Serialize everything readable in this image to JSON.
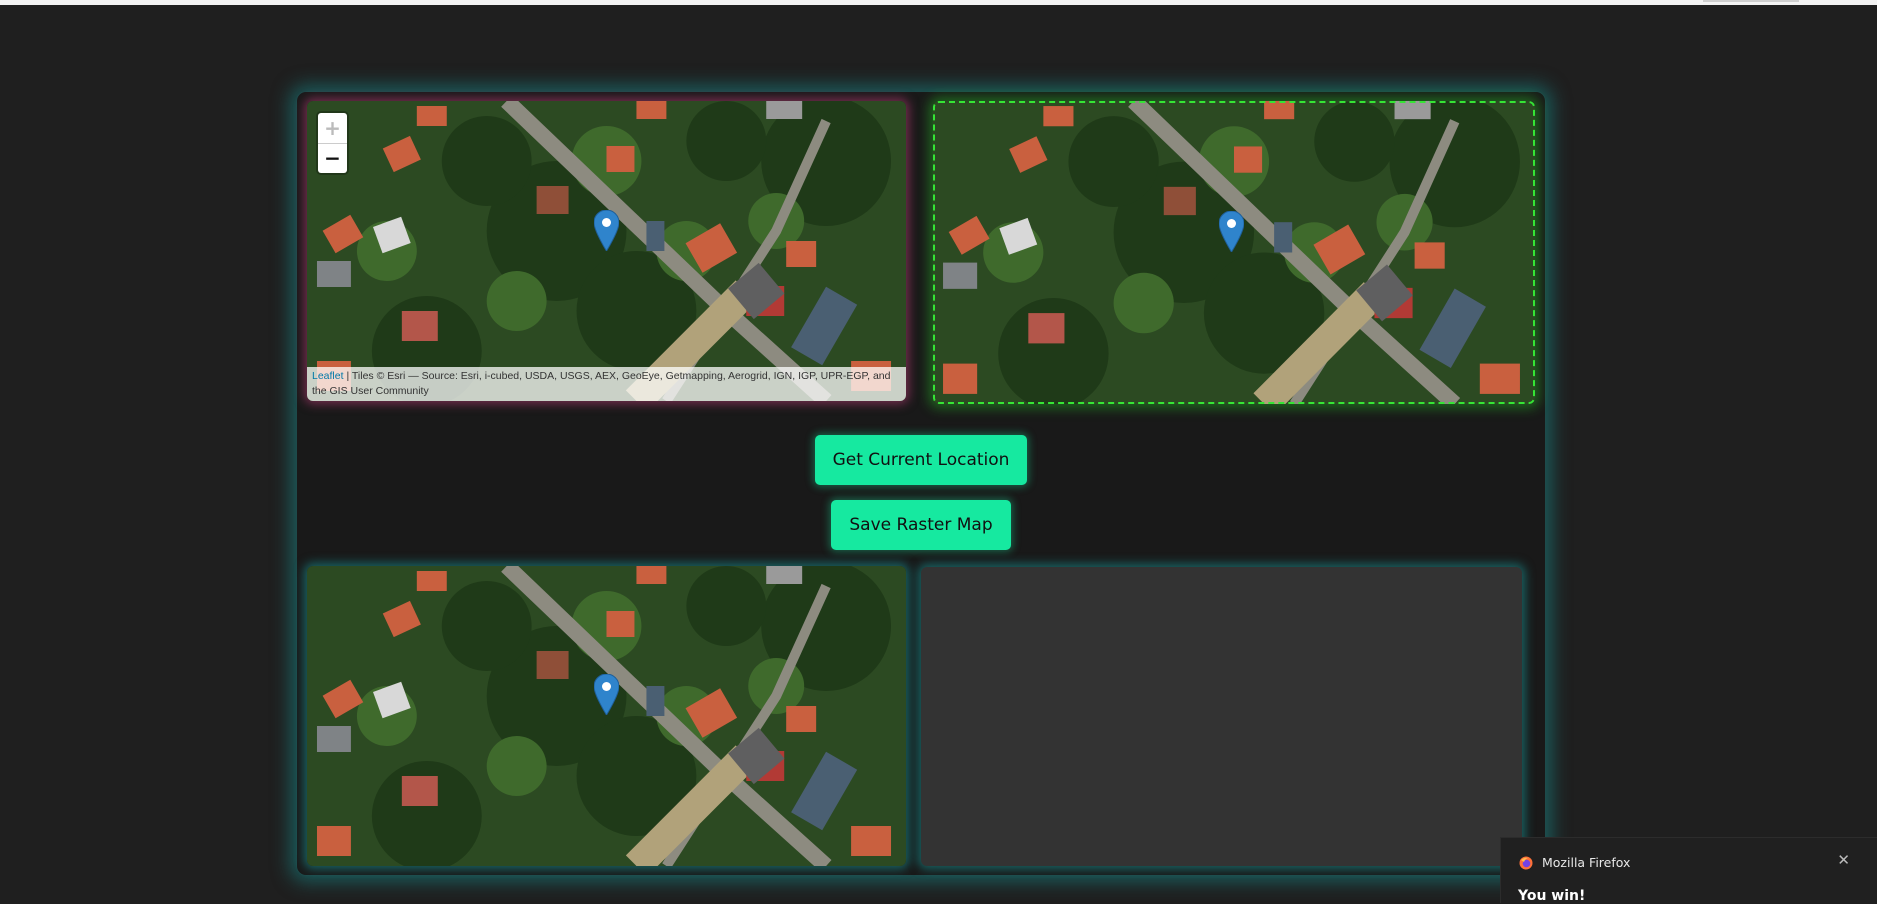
{
  "maps": {
    "attribution_link": "Leaflet",
    "attribution_text": " | Tiles © Esri — Source: Esri, i-cubed, USDA, USGS, AEX, GeoEye, Getmapping, Aerogrid, IGN, IGP, UPR-EGP, and the GIS User Community",
    "zoom_in": "+",
    "zoom_out": "−",
    "marker_color": "#2f84cc"
  },
  "buttons": {
    "get_location": "Get Current Location",
    "save_raster": "Save Raster Map"
  },
  "colors": {
    "accent": "#16e9a0",
    "frame_glow": "#1a9a9a",
    "result_border": "#35e535"
  },
  "notification": {
    "app": "Mozilla Firefox",
    "message": "You win!",
    "close": "✕"
  }
}
